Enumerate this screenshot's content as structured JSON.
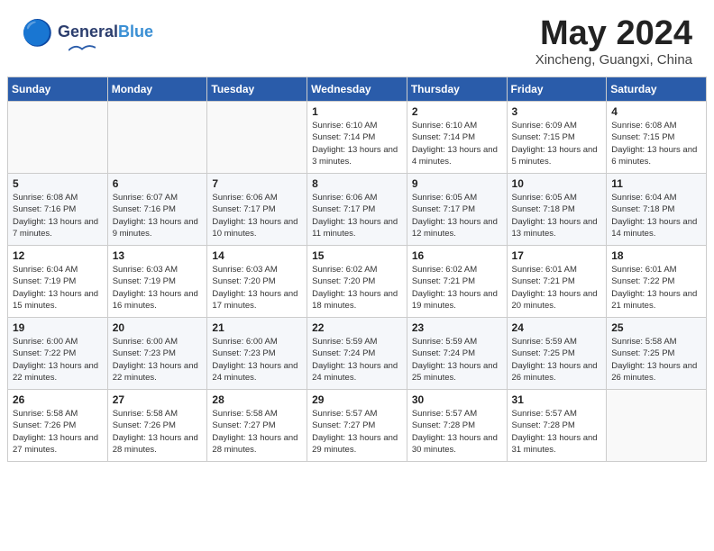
{
  "header": {
    "logo_line1": "General",
    "logo_line2": "Blue",
    "month": "May 2024",
    "location": "Xincheng, Guangxi, China"
  },
  "weekdays": [
    "Sunday",
    "Monday",
    "Tuesday",
    "Wednesday",
    "Thursday",
    "Friday",
    "Saturday"
  ],
  "weeks": [
    [
      {
        "day": "",
        "info": ""
      },
      {
        "day": "",
        "info": ""
      },
      {
        "day": "",
        "info": ""
      },
      {
        "day": "1",
        "info": "Sunrise: 6:10 AM\nSunset: 7:14 PM\nDaylight: 13 hours and 3 minutes."
      },
      {
        "day": "2",
        "info": "Sunrise: 6:10 AM\nSunset: 7:14 PM\nDaylight: 13 hours and 4 minutes."
      },
      {
        "day": "3",
        "info": "Sunrise: 6:09 AM\nSunset: 7:15 PM\nDaylight: 13 hours and 5 minutes."
      },
      {
        "day": "4",
        "info": "Sunrise: 6:08 AM\nSunset: 7:15 PM\nDaylight: 13 hours and 6 minutes."
      }
    ],
    [
      {
        "day": "5",
        "info": "Sunrise: 6:08 AM\nSunset: 7:16 PM\nDaylight: 13 hours and 7 minutes."
      },
      {
        "day": "6",
        "info": "Sunrise: 6:07 AM\nSunset: 7:16 PM\nDaylight: 13 hours and 9 minutes."
      },
      {
        "day": "7",
        "info": "Sunrise: 6:06 AM\nSunset: 7:17 PM\nDaylight: 13 hours and 10 minutes."
      },
      {
        "day": "8",
        "info": "Sunrise: 6:06 AM\nSunset: 7:17 PM\nDaylight: 13 hours and 11 minutes."
      },
      {
        "day": "9",
        "info": "Sunrise: 6:05 AM\nSunset: 7:17 PM\nDaylight: 13 hours and 12 minutes."
      },
      {
        "day": "10",
        "info": "Sunrise: 6:05 AM\nSunset: 7:18 PM\nDaylight: 13 hours and 13 minutes."
      },
      {
        "day": "11",
        "info": "Sunrise: 6:04 AM\nSunset: 7:18 PM\nDaylight: 13 hours and 14 minutes."
      }
    ],
    [
      {
        "day": "12",
        "info": "Sunrise: 6:04 AM\nSunset: 7:19 PM\nDaylight: 13 hours and 15 minutes."
      },
      {
        "day": "13",
        "info": "Sunrise: 6:03 AM\nSunset: 7:19 PM\nDaylight: 13 hours and 16 minutes."
      },
      {
        "day": "14",
        "info": "Sunrise: 6:03 AM\nSunset: 7:20 PM\nDaylight: 13 hours and 17 minutes."
      },
      {
        "day": "15",
        "info": "Sunrise: 6:02 AM\nSunset: 7:20 PM\nDaylight: 13 hours and 18 minutes."
      },
      {
        "day": "16",
        "info": "Sunrise: 6:02 AM\nSunset: 7:21 PM\nDaylight: 13 hours and 19 minutes."
      },
      {
        "day": "17",
        "info": "Sunrise: 6:01 AM\nSunset: 7:21 PM\nDaylight: 13 hours and 20 minutes."
      },
      {
        "day": "18",
        "info": "Sunrise: 6:01 AM\nSunset: 7:22 PM\nDaylight: 13 hours and 21 minutes."
      }
    ],
    [
      {
        "day": "19",
        "info": "Sunrise: 6:00 AM\nSunset: 7:22 PM\nDaylight: 13 hours and 22 minutes."
      },
      {
        "day": "20",
        "info": "Sunrise: 6:00 AM\nSunset: 7:23 PM\nDaylight: 13 hours and 22 minutes."
      },
      {
        "day": "21",
        "info": "Sunrise: 6:00 AM\nSunset: 7:23 PM\nDaylight: 13 hours and 24 minutes."
      },
      {
        "day": "22",
        "info": "Sunrise: 5:59 AM\nSunset: 7:24 PM\nDaylight: 13 hours and 24 minutes."
      },
      {
        "day": "23",
        "info": "Sunrise: 5:59 AM\nSunset: 7:24 PM\nDaylight: 13 hours and 25 minutes."
      },
      {
        "day": "24",
        "info": "Sunrise: 5:59 AM\nSunset: 7:25 PM\nDaylight: 13 hours and 26 minutes."
      },
      {
        "day": "25",
        "info": "Sunrise: 5:58 AM\nSunset: 7:25 PM\nDaylight: 13 hours and 26 minutes."
      }
    ],
    [
      {
        "day": "26",
        "info": "Sunrise: 5:58 AM\nSunset: 7:26 PM\nDaylight: 13 hours and 27 minutes."
      },
      {
        "day": "27",
        "info": "Sunrise: 5:58 AM\nSunset: 7:26 PM\nDaylight: 13 hours and 28 minutes."
      },
      {
        "day": "28",
        "info": "Sunrise: 5:58 AM\nSunset: 7:27 PM\nDaylight: 13 hours and 28 minutes."
      },
      {
        "day": "29",
        "info": "Sunrise: 5:57 AM\nSunset: 7:27 PM\nDaylight: 13 hours and 29 minutes."
      },
      {
        "day": "30",
        "info": "Sunrise: 5:57 AM\nSunset: 7:28 PM\nDaylight: 13 hours and 30 minutes."
      },
      {
        "day": "31",
        "info": "Sunrise: 5:57 AM\nSunset: 7:28 PM\nDaylight: 13 hours and 31 minutes."
      },
      {
        "day": "",
        "info": ""
      }
    ]
  ]
}
